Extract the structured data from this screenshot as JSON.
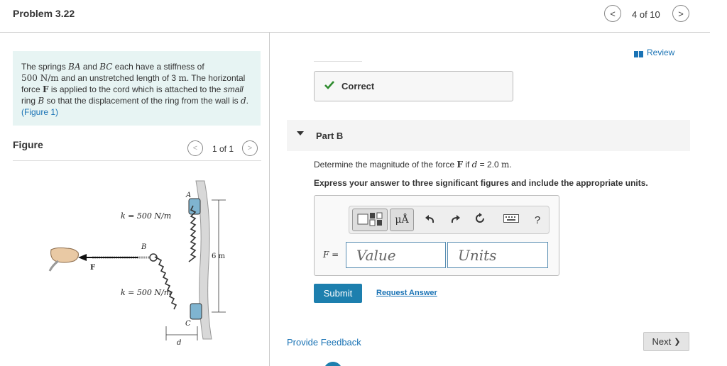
{
  "header": {
    "title": "Problem 3.22",
    "position": "4 of 10",
    "prev_glyph": "<",
    "next_glyph": ">"
  },
  "problem": {
    "t1": "The springs ",
    "m1": "BA",
    "t2": " and ",
    "m2": "BC",
    "t3": " each have a stiffness of",
    "m3": "500 N/m",
    "t4": " and an unstretched length of 3 ",
    "m4": "m",
    "t5": ". The horizontal force ",
    "m5": "F",
    "t6": " is applied to the cord which is attached to the ",
    "t6i": "small",
    "t7": " ring ",
    "m6": "B",
    "t8": " so that the displacement of the ring from the wall is ",
    "m7": "d",
    "t9": ". ",
    "fig_link": "(Figure 1)"
  },
  "figure": {
    "heading": "Figure",
    "count": "1 of 1",
    "labels": {
      "k_top": "k = 500 N/m",
      "k_bottom": "k = 500 N/m",
      "A": "A",
      "B": "B",
      "C": "C",
      "F": "F",
      "dim": "6 m",
      "d": "d"
    }
  },
  "review": {
    "label": "Review",
    "icon": "book-icon",
    "color": "#1a73b5"
  },
  "status": {
    "label": "Correct",
    "icon": "checkmark-icon",
    "color": "#2e8b2e"
  },
  "part": {
    "label": "Part B",
    "q_t1": "Determine the magnitude of the force ",
    "q_m1": "F",
    "q_t2": " if ",
    "q_m2": "d",
    "q_t3": " = 2.0 ",
    "q_m3": "m",
    "q_t4": ".",
    "instructions": "Express your answer to three significant figures and include the appropriate units."
  },
  "toolbar": {
    "mu_label": "μÅ",
    "help_label": "?",
    "icons": [
      "templates-icon",
      "symbols-icon",
      "undo-icon",
      "redo-icon",
      "reset-icon",
      "keyboard-icon",
      "help-icon"
    ]
  },
  "answer": {
    "var": "F",
    "eq": " =",
    "value_placeholder": "Value",
    "units_placeholder": "Units"
  },
  "actions": {
    "submit": "Submit",
    "request": "Request Answer",
    "feedback": "Provide Feedback",
    "next": "Next",
    "next_glyph": "❯"
  },
  "colors": {
    "accent": "#1d7fae",
    "link": "#1a73b5",
    "problem_bg": "#e7f4f3"
  }
}
